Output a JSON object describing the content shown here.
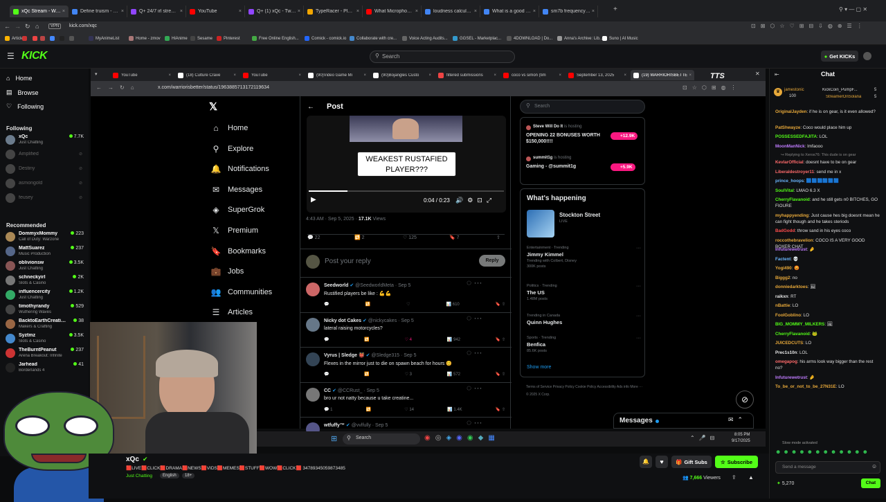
{
  "browser": {
    "tabs": [
      {
        "label": "xQc Stream - Watch Live",
        "color": "#53fc18",
        "active": true
      },
      {
        "label": "Define truism - Google S",
        "color": "#4285f4"
      },
      {
        "label": "Q+ 24/7 irl stream in Am",
        "color": "#9146ff"
      },
      {
        "label": "YouTube",
        "color": "#ff0000"
      },
      {
        "label": "Q+ (1) xQc - Twitch",
        "color": "#9146ff"
      },
      {
        "label": "TypeRacer - Play Typing G",
        "color": "#f2a600"
      },
      {
        "label": "What Microphone Does S",
        "color": "#ff0000"
      },
      {
        "label": "loudness calculator file",
        "color": "#4285f4"
      },
      {
        "label": "What is a good ratio for",
        "color": "#4285f4"
      },
      {
        "label": "sm7b frequency respons",
        "color": "#4285f4"
      }
    ],
    "url": "kick.com/xqc",
    "bookmarks": [
      "Articles",
      "",
      "",
      "",
      "",
      "",
      "",
      "MyAnimeList",
      "Home - zmov",
      "HiAnime",
      "Sesame",
      "Pinterest",
      "Free Online English...",
      "Comick - comick.io",
      "Collaborate with cre...",
      "Voice Acting Audits...",
      "GGSEL - Marketplac...",
      "4DOWNLOAD | Do...",
      "Anna's Archive: Lib...",
      "Suno | AI Music"
    ]
  },
  "kick": {
    "logo": "KICK",
    "search_placeholder": "Search",
    "get_kicks": "Get KICKs",
    "nav": {
      "home": "Home",
      "browse": "Browse",
      "following": "Following"
    },
    "following_header": "Following",
    "following": [
      {
        "name": "xQc",
        "category": "Just Chatting",
        "viewers": "7.7K",
        "color": "#6b7b8c"
      },
      {
        "name": "Amplified",
        "off": true,
        "color": "#444"
      },
      {
        "name": "Destiny",
        "off": true,
        "color": "#444"
      },
      {
        "name": "asmongold",
        "off": true,
        "color": "#444"
      },
      {
        "name": "feusey",
        "off": true,
        "color": "#444"
      }
    ],
    "recommended_header": "Recommended",
    "recommended": [
      {
        "name": "DommyxMommy",
        "category": "Call of Duty: Warzone",
        "viewers": "223",
        "color": "#a85"
      },
      {
        "name": "MattSuarez",
        "category": "Music Production",
        "viewers": "237",
        "color": "#568"
      },
      {
        "name": "oblivionsw",
        "category": "Just Chatting",
        "viewers": "3.5K",
        "color": "#855"
      },
      {
        "name": "schneckyirl",
        "category": "Slots & Casino",
        "viewers": "2K",
        "color": "#777"
      },
      {
        "name": "influencercity",
        "category": "Just Chatting",
        "viewers": "1.2K",
        "color": "#3a6"
      },
      {
        "name": "timothyrandy",
        "category": "Wuthering Waves",
        "viewers": "529",
        "color": "#444"
      },
      {
        "name": "BacktoEarthCreations",
        "category": "Makers & Crafting",
        "viewers": "38",
        "color": "#964"
      },
      {
        "name": "Syztmz",
        "category": "Slots & Casino",
        "viewers": "3.5K",
        "color": "#48c"
      },
      {
        "name": "TheBurntPeanut",
        "category": "Arena Breakout: Infinite",
        "viewers": "237",
        "color": "#c33"
      },
      {
        "name": "Jarhead",
        "category": "Borderlands 4",
        "viewers": "41",
        "color": "#222"
      }
    ]
  },
  "inner_browser": {
    "tabs": [
      "YouTube",
      "(18) Culture Crave",
      "YouTube",
      "(90)Video Game Mi",
      "(90)Bojangles Custo",
      "filtered submissions",
      "coco vs simon (tim",
      "September 13, 2025",
      "(19) WARRIORISBETTE"
    ],
    "url": "x.com/warriorisbetter/status/1963885713172119634"
  },
  "x": {
    "nav": [
      {
        "label": "Home",
        "icon": "⌂"
      },
      {
        "label": "Explore",
        "icon": "⚲"
      },
      {
        "label": "Notifications",
        "icon": "🔔"
      },
      {
        "label": "Messages",
        "icon": "✉"
      },
      {
        "label": "SuperGrok",
        "icon": "◈"
      },
      {
        "label": "Premium",
        "icon": "𝕏"
      },
      {
        "label": "Bookmarks",
        "icon": "🔖"
      },
      {
        "label": "Jobs",
        "icon": "💼"
      },
      {
        "label": "Communities",
        "icon": "👥"
      },
      {
        "label": "Articles",
        "icon": "☰"
      }
    ],
    "post_header": "Post",
    "video_caption": "WEAKEST RUSTAFIED PLAYER???",
    "video_time": "0:04 / 0:23",
    "post_meta": "4:43 AM · Sep 5, 2025 · ",
    "post_views": "17.1K",
    "post_views_label": " Views",
    "counts": {
      "replies": "22",
      "reposts": "2",
      "likes": "125",
      "bookmarks": "7"
    },
    "reply_placeholder": "Post your reply",
    "reply_button": "Reply",
    "replies": [
      {
        "name": "Seedworld",
        "handle": "@SeedworldMeta · Sep 5",
        "text": "Rustified players be like : 💪💪",
        "replies": "",
        "reposts": "",
        "likes": "",
        "views": "610",
        "color": "#c66"
      },
      {
        "name": "Nicky dot Cakes",
        "handle": "@nickycakes · Sep 5",
        "text": "lateral raising motorcycles?",
        "replies": "",
        "reposts": "",
        "likes": "4",
        "views": "942",
        "color": "#678"
      },
      {
        "name": "Vyrus | Sledge 👹",
        "handle": "@Sledge315 · Sep 5",
        "text": "Flexes in the mirror just to die on spawn beach for hours 😊",
        "replies": "",
        "reposts": "",
        "likes": "3",
        "views": "572",
        "color": "#345"
      },
      {
        "name": "CC",
        "handle": "@CCRust_ · Sep 5",
        "text": "bro ur not natty because u take creatine...",
        "replies": "1",
        "reposts": "",
        "likes": "14",
        "views": "1.4K",
        "color": "#777"
      },
      {
        "name": "wtfuffy™",
        "handle": "@vvlfully · Sep 5",
        "text": "",
        "replies": "",
        "reposts": "",
        "likes": "",
        "views": "",
        "color": "#558"
      }
    ],
    "search_placeholder": "Search",
    "live_items": [
      {
        "host": "Steve Will Do It",
        "status": "is hosting",
        "title": "OPENING 22 BONUSES WORTH $150,000!!!!",
        "badge": "+12.9K"
      },
      {
        "host": "summit1g",
        "status": "is hosting",
        "title": "Gaming - @summit1g",
        "badge": "+5.9K"
      }
    ],
    "happening_title": "What's happening",
    "happening_event": {
      "title": "Stockton Street",
      "status": "LIVE"
    },
    "trends": [
      {
        "context": "Entertainment · Trending",
        "title": "Jimmy Kimmel",
        "extra": "Trending with Colbert, Disney",
        "count": "300K posts"
      },
      {
        "context": "Politics · Trending",
        "title": "The US",
        "count": "1.48M posts"
      },
      {
        "context": "Trending in Canada",
        "title": "Quinn Hughes",
        "count": ""
      },
      {
        "context": "Sports · Trending",
        "title": "Benfica",
        "count": "85.6K posts"
      }
    ],
    "show_more": "Show more",
    "footer": "Terms of Service   Privacy Policy   Cookie Policy   Accessibility   Ads info   More ···   © 2025 X Corp.",
    "messages_label": "Messages"
  },
  "taskbar": {
    "search": "Search",
    "time": "8:05 PM",
    "date": "9/17/2025"
  },
  "chat": {
    "title": "Chat",
    "pinned": {
      "name": "jamestonic",
      "count": "100",
      "right1": "KickCoin_PumpF...",
      "right2": "StreamerOnSolana",
      "n1": "5",
      "n2": "5"
    },
    "messages": [
      {
        "user": "OriginalJayden",
        "color": "#e8a93a",
        "text": "if he is on gear, is it even allowed?"
      },
      {
        "user": "PatShwayze",
        "color": "#e8a93a",
        "text": "Coco would place him up"
      },
      {
        "user": "POSSESSEDFAJITA",
        "color": "#53fc18",
        "text": "LOL"
      },
      {
        "user": "MoonManNick",
        "color": "#c07cff",
        "text": "lmfaooo"
      },
      {
        "user": "KevlarOfficial",
        "color": "#ff6b6b",
        "text": "doesnt have to be on gear",
        "reply": "Replying to Xeros76: This dude is on gear"
      },
      {
        "user": "Liberaldestroyer11",
        "color": "#ff6b6b",
        "text": "send me in x"
      },
      {
        "user": "prince_hoops",
        "color": "#6bb7ff",
        "text": "🟦🟦🟦🟦🟦🟦"
      },
      {
        "user": "SoulVital",
        "color": "#53fc18",
        "text": "LMAO 6.3 X"
      },
      {
        "user": "CherryFlavanoid",
        "color": "#53fc18",
        "text": "and he still gets n0 BITCHES, GO FIOURE"
      },
      {
        "user": "myhappyending",
        "color": "#e8a93a",
        "text": "Just cause hes big doesnt mean he can fight though and he takes steriods"
      },
      {
        "user": "BadGodd",
        "color": "#ff4d4d",
        "text": "throw sand in his eyes coco"
      },
      {
        "user": "roccothebravelion",
        "color": "#e8a93a",
        "text": "COCO IS A VERY GOOD BOXER CHAT"
      },
      {
        "user": "Infuturewetrust",
        "color": "#c07cff",
        "text": "🤌"
      },
      {
        "user": "Factent",
        "color": "#6bb7ff",
        "text": "💀"
      },
      {
        "user": "Yogi490",
        "color": "#e8a93a",
        "text": "😡"
      },
      {
        "user": "Biggg2",
        "color": "#e8a93a",
        "text": "no"
      },
      {
        "user": "donniedarktoes",
        "color": "#e8a93a",
        "text": "🖼"
      },
      {
        "user": "raikxn",
        "color": "#e8e8e8",
        "text": "RT"
      },
      {
        "user": "nBattie",
        "color": "#e8a93a",
        "text": "LO"
      },
      {
        "user": "FoolGoblino",
        "color": "#e8a93a",
        "text": "LO"
      },
      {
        "user": "BIG_MOMMY_MILKERS",
        "color": "#53fc18",
        "text": "🖼"
      },
      {
        "user": "CherryFlavanoid",
        "color": "#53fc18",
        "text": "🐸"
      },
      {
        "user": "JUICEDCUTS",
        "color": "#e8a93a",
        "text": "LO"
      },
      {
        "user": "Prec1s10n",
        "color": "#e8e8e8",
        "text": "LOL"
      },
      {
        "user": "omegapog",
        "color": "#ff6b6b",
        "text": "his arms look way bigger than the rest no?"
      },
      {
        "user": "Infuturewetrust",
        "color": "#c07cff",
        "text": "🤌"
      },
      {
        "user": "To_be_or_not_to_be_27N31E",
        "color": "#e8a93a",
        "text": "LO"
      }
    ],
    "slow_mode": "Slow mode activated",
    "input_placeholder": "Send a message",
    "points": "5,270",
    "send": "Chat"
  },
  "stream": {
    "streamer": "xQc",
    "title": "🟥LIVE🟥CLICK🟥DRAMA🟥NEWS🟥VIDS🟥MEMES🟥STUFF🟥WOW🟥CLICK🟥 34789345059873485",
    "category": "Just Chatting",
    "tags": [
      "English",
      "18+"
    ],
    "gift_subs": "Gift Subs",
    "subscribe": "Subscribe",
    "viewers": "7,666",
    "viewers_label": " Viewers"
  },
  "colors": {
    "kick_green": "#53fc18",
    "x_blue": "#1d9bf0",
    "bg": "#0b0c0d"
  }
}
